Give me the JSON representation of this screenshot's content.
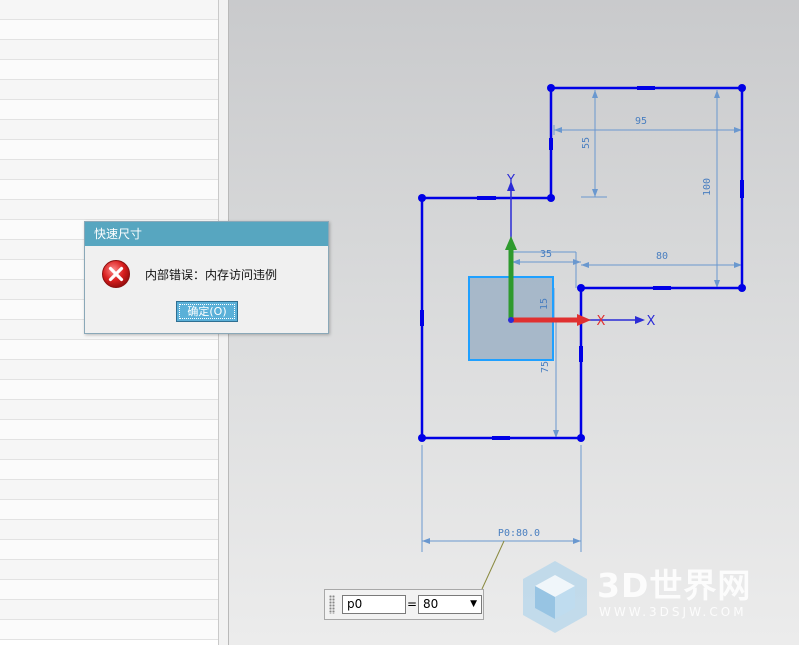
{
  "dialog": {
    "title": "快速尺寸",
    "message": "内部错误：内存访问违例",
    "ok_label": "确定(O)"
  },
  "sketch": {
    "dimensions": {
      "d95": "95",
      "d55": "55",
      "d100": "100",
      "d35": "35",
      "d80": "80",
      "d15": "15",
      "d75": "75",
      "p0": "P0:80.0"
    },
    "axes": {
      "y_label": "Y",
      "x_label_inner": "X",
      "x_label_outer": "X"
    }
  },
  "input_bar": {
    "name_value": "p0",
    "equals": "=",
    "value": "80"
  },
  "watermark": {
    "brand": "3D世界网",
    "url": "WWW.3DSJW.COM"
  },
  "colors": {
    "sketch_line": "#0000e6",
    "dimension": "#4a7fc0",
    "titlebar": "#57a6c0",
    "x_axis": "#e03030",
    "y_axis": "#2e9a2e"
  }
}
